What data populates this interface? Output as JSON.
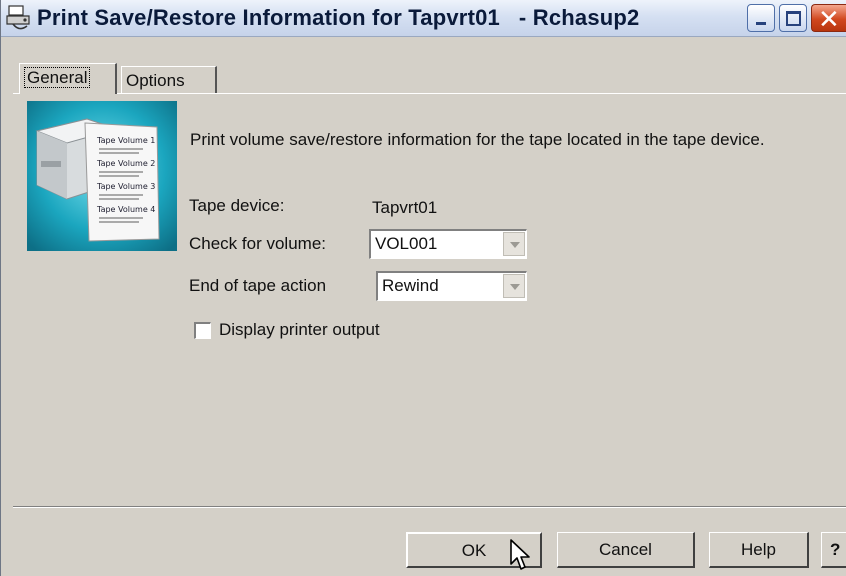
{
  "window": {
    "title": "Print Save/Restore Information for Tapvrt01   - Rchasup2",
    "controls": {
      "minimize": "minimize-icon",
      "maximize": "maximize-icon",
      "close": "close-icon"
    }
  },
  "tabs": [
    {
      "label": "General",
      "selected": true
    },
    {
      "label": "Options",
      "selected": false
    }
  ],
  "illustration": {
    "lines": [
      "Tape Volume 1",
      "Tape Volume 2",
      "Tape Volume 3",
      "Tape Volume 4"
    ]
  },
  "form": {
    "description": "Print volume save/restore information for the tape located in the tape device.",
    "tape_device_label": "Tape device:",
    "tape_device_value": "Tapvrt01",
    "check_volume_label": "Check for volume:",
    "check_volume_value": "VOL001",
    "end_action_label": "End of tape action",
    "end_action_value": "Rewind",
    "display_output_label": "Display printer output",
    "display_output_checked": false
  },
  "buttons": {
    "ok": "OK",
    "cancel": "Cancel",
    "help": "Help",
    "question": "?"
  },
  "colors": {
    "face": "#d4d0c8",
    "title_text": "#0a1a3a",
    "close_button": "#d1481f",
    "illustration_bg": "#1ba6bf"
  }
}
